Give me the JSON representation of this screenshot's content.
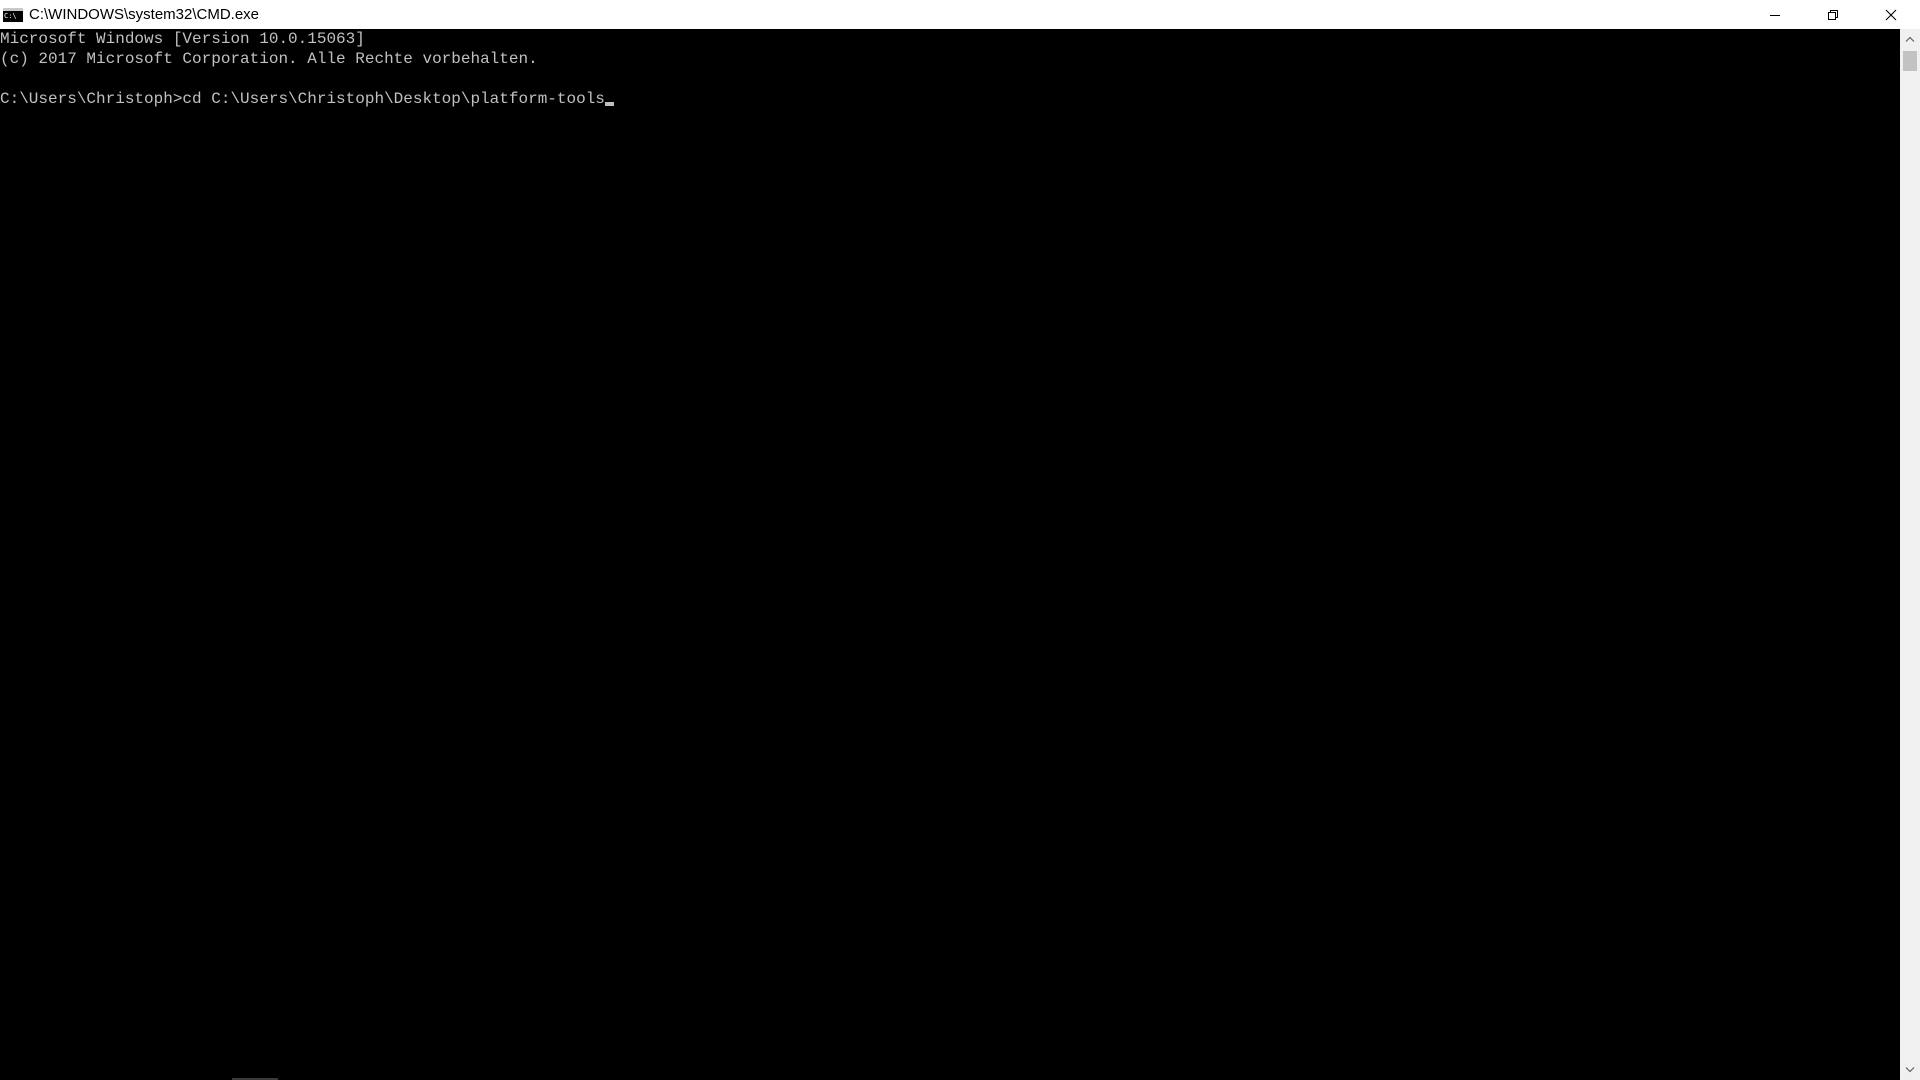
{
  "window": {
    "title": "C:\\WINDOWS\\system32\\CMD.exe",
    "app_icon": "cmd-icon",
    "app_icon_text": "C:\\"
  },
  "caption_buttons": {
    "minimize_icon": "minimize-icon",
    "restore_icon": "restore-icon",
    "close_icon": "close-icon"
  },
  "console": {
    "lines": [
      "Microsoft Windows [Version 10.0.15063]",
      "(c) 2017 Microsoft Corporation. Alle Rechte vorbehalten.",
      "",
      "C:\\Users\\Christoph>cd C:\\Users\\Christoph\\Desktop\\platform-tools"
    ],
    "text_color": "#c0c0c0",
    "background_color": "#000000"
  },
  "scrollbar": {
    "up_icon": "chevron-up-icon",
    "down_icon": "chevron-down-icon"
  }
}
